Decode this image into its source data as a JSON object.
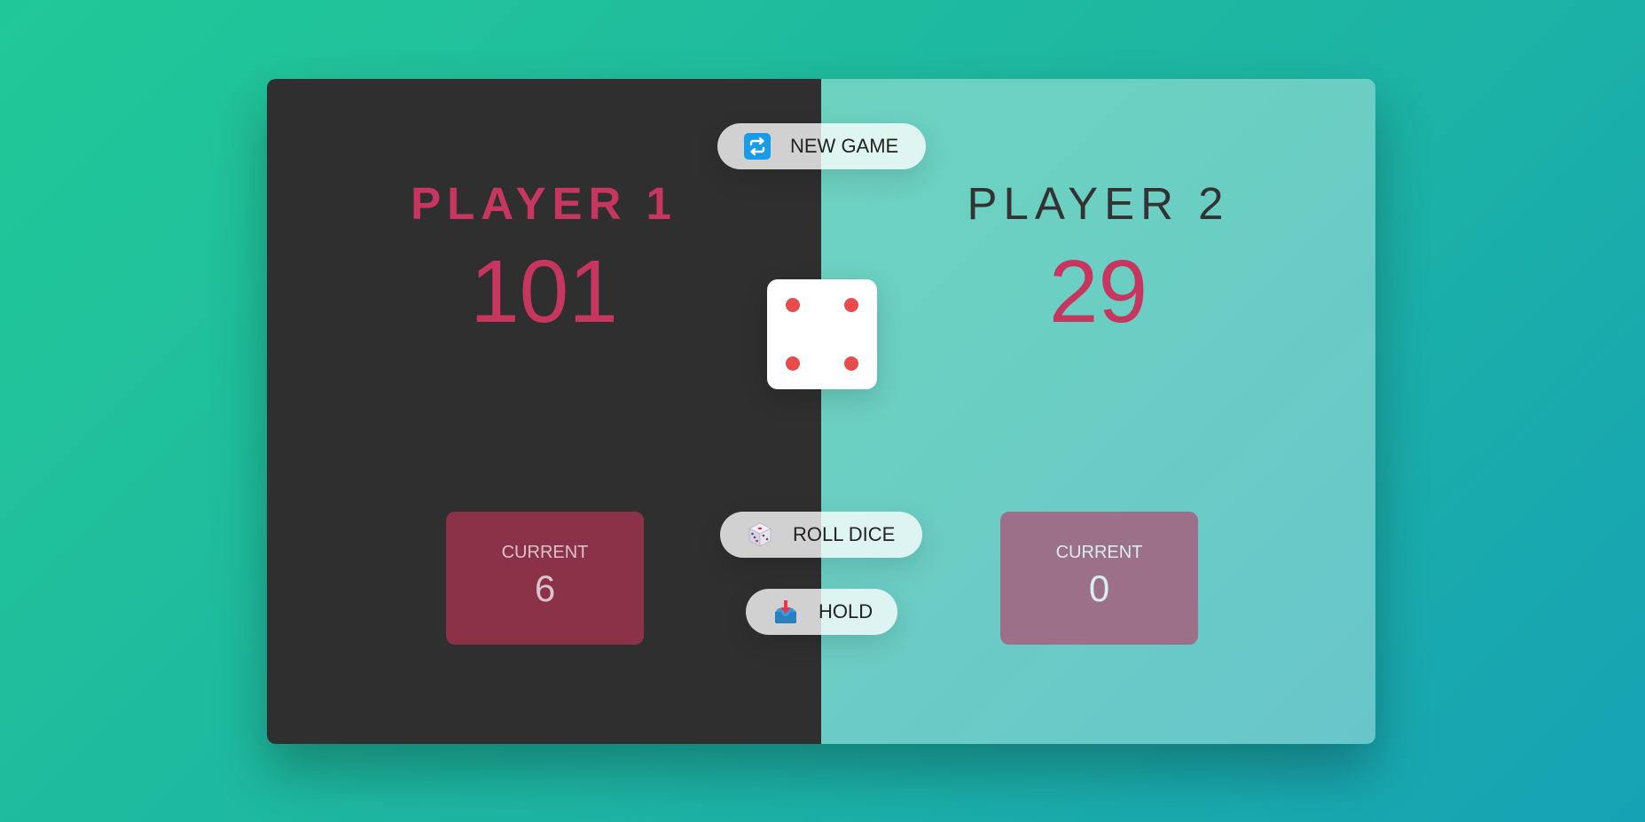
{
  "players": [
    {
      "name": "PLAYER 1",
      "score": "101",
      "current_label": "CURRENT",
      "current_value": "6"
    },
    {
      "name": "PLAYER 2",
      "score": "29",
      "current_label": "CURRENT",
      "current_value": "0"
    }
  ],
  "buttons": {
    "new_game": {
      "label": "NEW GAME",
      "icon": "refresh-icon"
    },
    "roll_dice": {
      "label": "ROLL DICE",
      "icon": "dice-icon"
    },
    "hold": {
      "label": "HOLD",
      "icon": "inbox-tray-icon"
    }
  },
  "dice": {
    "value": 4,
    "pip_color": "#e74c4c"
  },
  "colors": {
    "accent": "#c7365f",
    "active_panel": "#302f30",
    "new_game_icon": "#1a9be8"
  }
}
